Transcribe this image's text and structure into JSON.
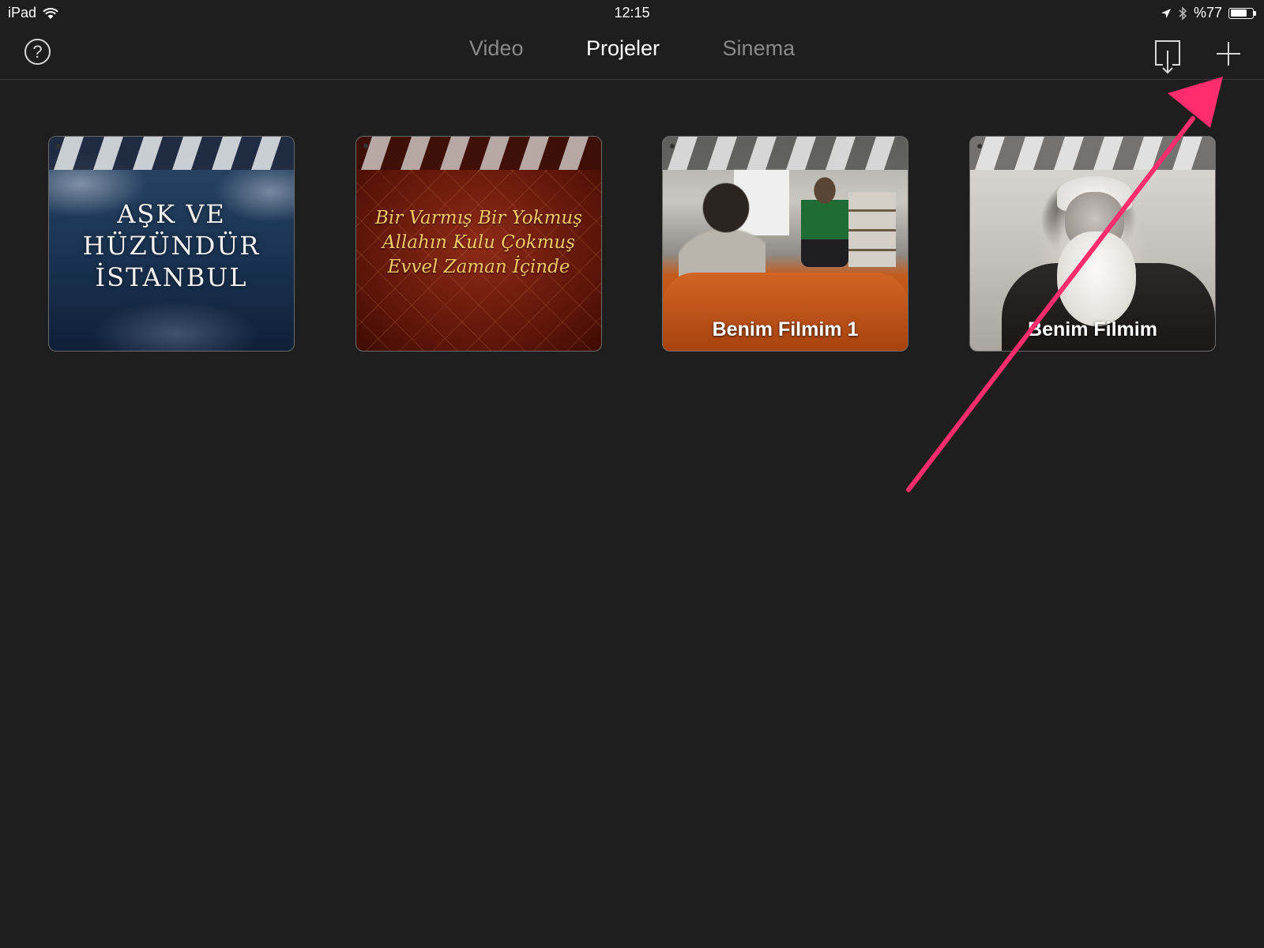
{
  "status_bar": {
    "device": "iPad",
    "time": "12:15",
    "battery": "%77",
    "battery_level": 0.77
  },
  "nav": {
    "help_icon": "question-circle-icon",
    "tabs": [
      {
        "label": "Video",
        "active": false
      },
      {
        "label": "Projeler",
        "active": true
      },
      {
        "label": "Sinema",
        "active": false
      }
    ],
    "import_icon": "import-download-icon",
    "add_icon": "plus-icon"
  },
  "projects": [
    {
      "title_lines": [
        "AŞK VE",
        "HÜZÜNDÜR",
        "İSTANBUL"
      ],
      "theme": "cloudy-night-sky"
    },
    {
      "title_lines": [
        "Bir Varmış Bir Yokmuş",
        "Allahın Kulu Çokmuş",
        "Evvel Zaman İçinde"
      ],
      "theme": "ornate-red"
    },
    {
      "title": "Benim Filmim 1",
      "theme": "classroom-photo"
    },
    {
      "title": "Benim Filmim",
      "theme": "bw-portrait"
    }
  ],
  "colors": {
    "background": "#1e1e1e",
    "tab_active": "#ffffff",
    "tab_inactive": "#8a8a8a",
    "annotation": "#ff2d6b"
  }
}
